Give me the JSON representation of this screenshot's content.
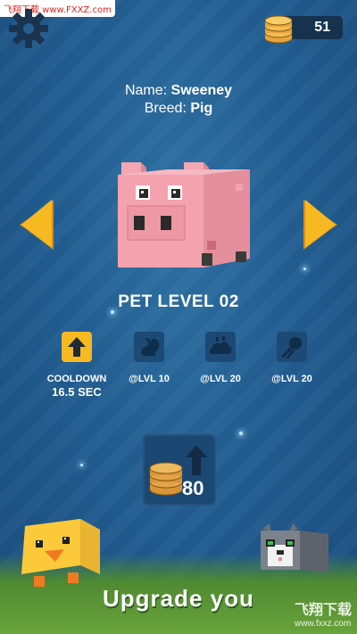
{
  "watermark": {
    "top": "飞翔下载 www.FXXZ.com",
    "bottom_cn": "飞翔下载",
    "bottom_url": "www.fxxz.com"
  },
  "header": {
    "coins": "51",
    "settings_icon": "gear-icon",
    "coin_icon": "coin-stack-icon"
  },
  "pet": {
    "name_label": "Name:",
    "name": "Sweeney",
    "breed_label": "Breed:",
    "breed": "Pig"
  },
  "level": {
    "title": "PET LEVEL 02"
  },
  "abilities": [
    {
      "label": "COOLDOWN",
      "value": "16.5 SEC",
      "icon": "arrow-up-icon",
      "active": true
    },
    {
      "label": "@LVL 10",
      "value": "",
      "icon": "squirrel-icon",
      "active": false
    },
    {
      "label": "@LVL 20",
      "value": "",
      "icon": "cloud-icon",
      "active": false
    },
    {
      "label": "@LVL 20",
      "value": "",
      "icon": "comet-icon",
      "active": false
    }
  ],
  "upgrade": {
    "price": "80",
    "icon": "coins-upgrade-icon"
  },
  "banner": {
    "text": "Upgrade you"
  },
  "colors": {
    "accent": "#f6b921",
    "background": "#235e92",
    "banner": "#5e9a36"
  }
}
